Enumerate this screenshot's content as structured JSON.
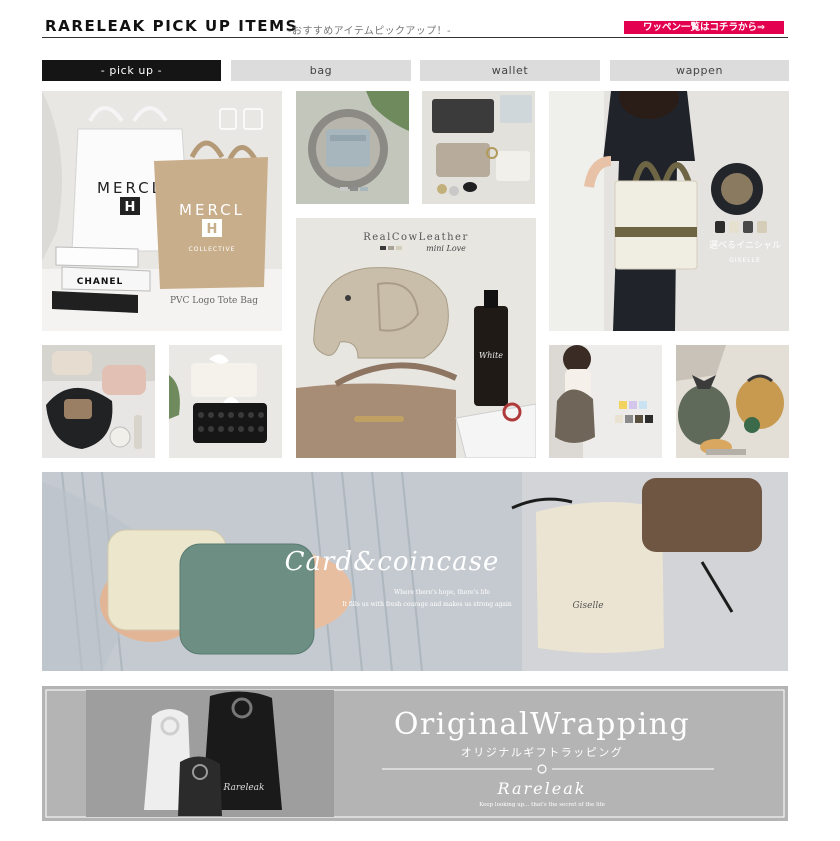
{
  "header": {
    "title": "RARELEAK PICK UP ITEMS",
    "subtitle": "-おすすめアイテムピックアップ！-",
    "wappen_link": "ワッペン一覧はコチラから⇒"
  },
  "tabs": [
    {
      "label": "- pick up -",
      "active": true
    },
    {
      "label": "bag",
      "active": false
    },
    {
      "label": "wallet",
      "active": false
    },
    {
      "label": "wappen",
      "active": false
    }
  ],
  "tiles": {
    "tote": {
      "brand": "MERCL",
      "letter": "H",
      "sub": "COLLECTIVE",
      "caption": "PVC Logo Tote Bag",
      "book": "CHANEL"
    },
    "elephant": {
      "caption": "RealCowLeather",
      "script": "mini Love"
    },
    "canvas": {
      "script": "選べるイニシャル",
      "brand": "GISELLE"
    },
    "card_banner": {
      "script": "Card&coincase",
      "line1": "Where there's hope, there's life",
      "line2": "It fills us with fresh courage and makes us strong again",
      "pouch_mark": "Giselle"
    },
    "wrapping_banner": {
      "title": "OriginalWrapping",
      "subtitle": "オリジナルギフトラッピング",
      "brand": "Rareleak",
      "tagline": "Keep looking up... that's the secret of the life",
      "bag_mark": "Rareleak"
    }
  },
  "colors": {
    "accent": "#e2004f",
    "tab_active": "#151515",
    "tab_inactive": "#dcdcdc",
    "banner_gray": "#b4b4b4"
  }
}
